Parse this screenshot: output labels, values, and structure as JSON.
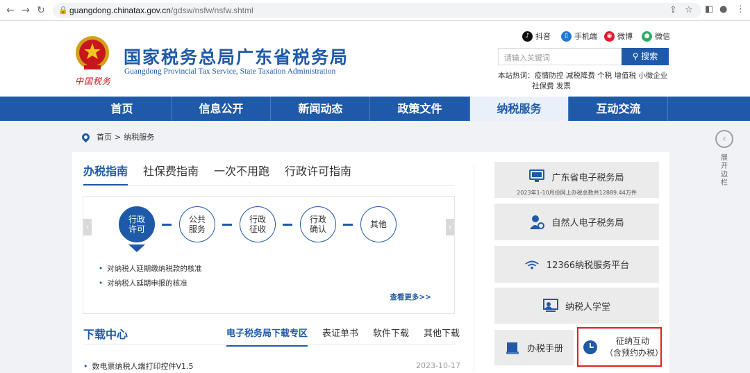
{
  "browser": {
    "url_host": "guangdong.chinatax.gov.cn",
    "url_path": "/gdsw/nsfw/nsfw.shtml"
  },
  "header": {
    "emblem_text": "中国税务",
    "title": "国家税务总局广东省税务局",
    "subtitle": "Guangdong Provincial Tax Service, State Taxation Administration",
    "social": [
      {
        "label": "抖音",
        "icon": "tiktok-icon",
        "color": "#111111"
      },
      {
        "label": "手机端",
        "icon": "mobile-icon",
        "color": "#1f7ad6"
      },
      {
        "label": "微博",
        "icon": "weibo-icon",
        "color": "#e6162d"
      },
      {
        "label": "微信",
        "icon": "wechat-icon",
        "color": "#2aae67"
      }
    ],
    "search": {
      "placeholder": "请输入关键词",
      "button": "搜索"
    },
    "hot": {
      "label": "本站热词：",
      "words_line1": "疫情防控 减税降费 个税 增值税 小微企业",
      "words_line2": "社保费 发票"
    }
  },
  "nav": {
    "items": [
      "首页",
      "信息公开",
      "新闻动态",
      "政策文件",
      "纳税服务",
      "互动交流"
    ],
    "active_index": 4
  },
  "breadcrumb": {
    "home": "首页",
    "sep": ">",
    "current": "纳税服务"
  },
  "side": {
    "expand_text": "展开边栏"
  },
  "guide": {
    "tabs": [
      "办税指南",
      "社保费指南",
      "一次不用跑",
      "行政许可指南"
    ],
    "flow": [
      "行政许可",
      "公共服务",
      "行政征收",
      "行政确认",
      "其他"
    ],
    "items": [
      "对纳税人延期缴纳税款的核准",
      "对纳税人延期申报的核准"
    ],
    "more": "查看更多>>"
  },
  "download": {
    "title": "下载中心",
    "tabs": [
      "电子税务局下载专区",
      "表证单书",
      "软件下载",
      "其他下载"
    ],
    "item": "数电票纳税人端打印控件V1.5",
    "date": "2023-10-17"
  },
  "services": {
    "etax": {
      "label": "广东省电子税务局",
      "sub": "2023年1-10月份网上办税总数共12889.44万件"
    },
    "natural": {
      "label": "自然人电子税务局"
    },
    "hotline": {
      "label": "12366纳税服务平台"
    },
    "school": {
      "label": "纳税人学堂"
    },
    "manual": {
      "label": "办税手册"
    },
    "interact": {
      "label_line1": "征纳互动",
      "label_line2": "（含预约办税）"
    }
  },
  "colors": {
    "brand": "#1f5aa8",
    "highlight": "#e02020"
  }
}
